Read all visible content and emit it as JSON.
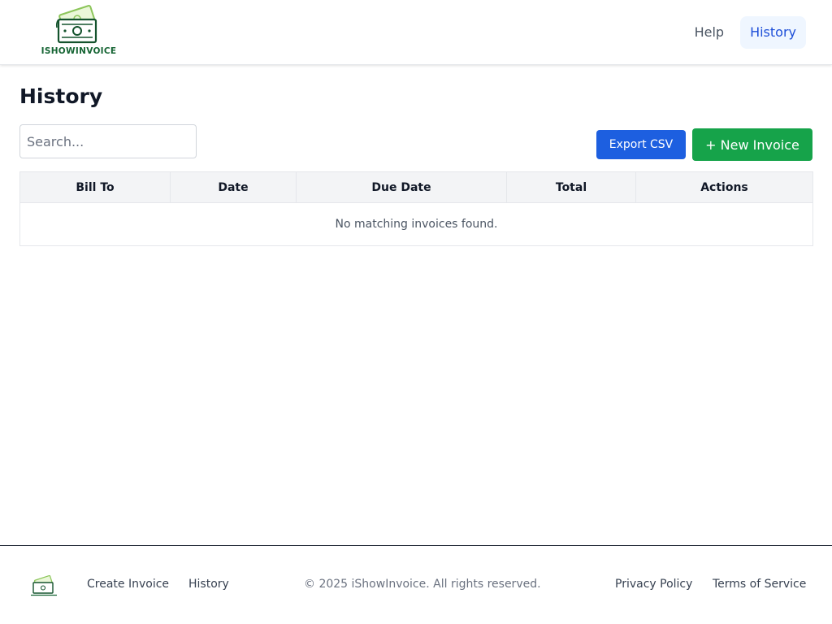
{
  "brand": {
    "name": "iShowInvoice",
    "logo_text": "iShowInvoice",
    "color": "#166534"
  },
  "nav": {
    "help": "Help",
    "history": "History",
    "active": "history"
  },
  "page": {
    "title": "History"
  },
  "search": {
    "placeholder": "Search...",
    "value": ""
  },
  "actions": {
    "export_label": "Export CSV",
    "new_label": "+ New Invoice"
  },
  "table": {
    "columns": [
      "Bill To",
      "Date",
      "Due Date",
      "Total",
      "Actions"
    ],
    "rows": [],
    "empty_message": "No matching invoices found."
  },
  "footer": {
    "links_left": [
      "Create Invoice",
      "History"
    ],
    "copyright": "© 2025 iShowInvoice. All rights reserved.",
    "links_right": [
      "Privacy Policy",
      "Terms of Service"
    ]
  },
  "colors": {
    "primary": "#1d5fe0",
    "success": "#16a34a",
    "nav_active_bg": "#eff6ff",
    "nav_active_text": "#1d4ed8"
  },
  "icons": {
    "logo": "money-stack-icon"
  }
}
